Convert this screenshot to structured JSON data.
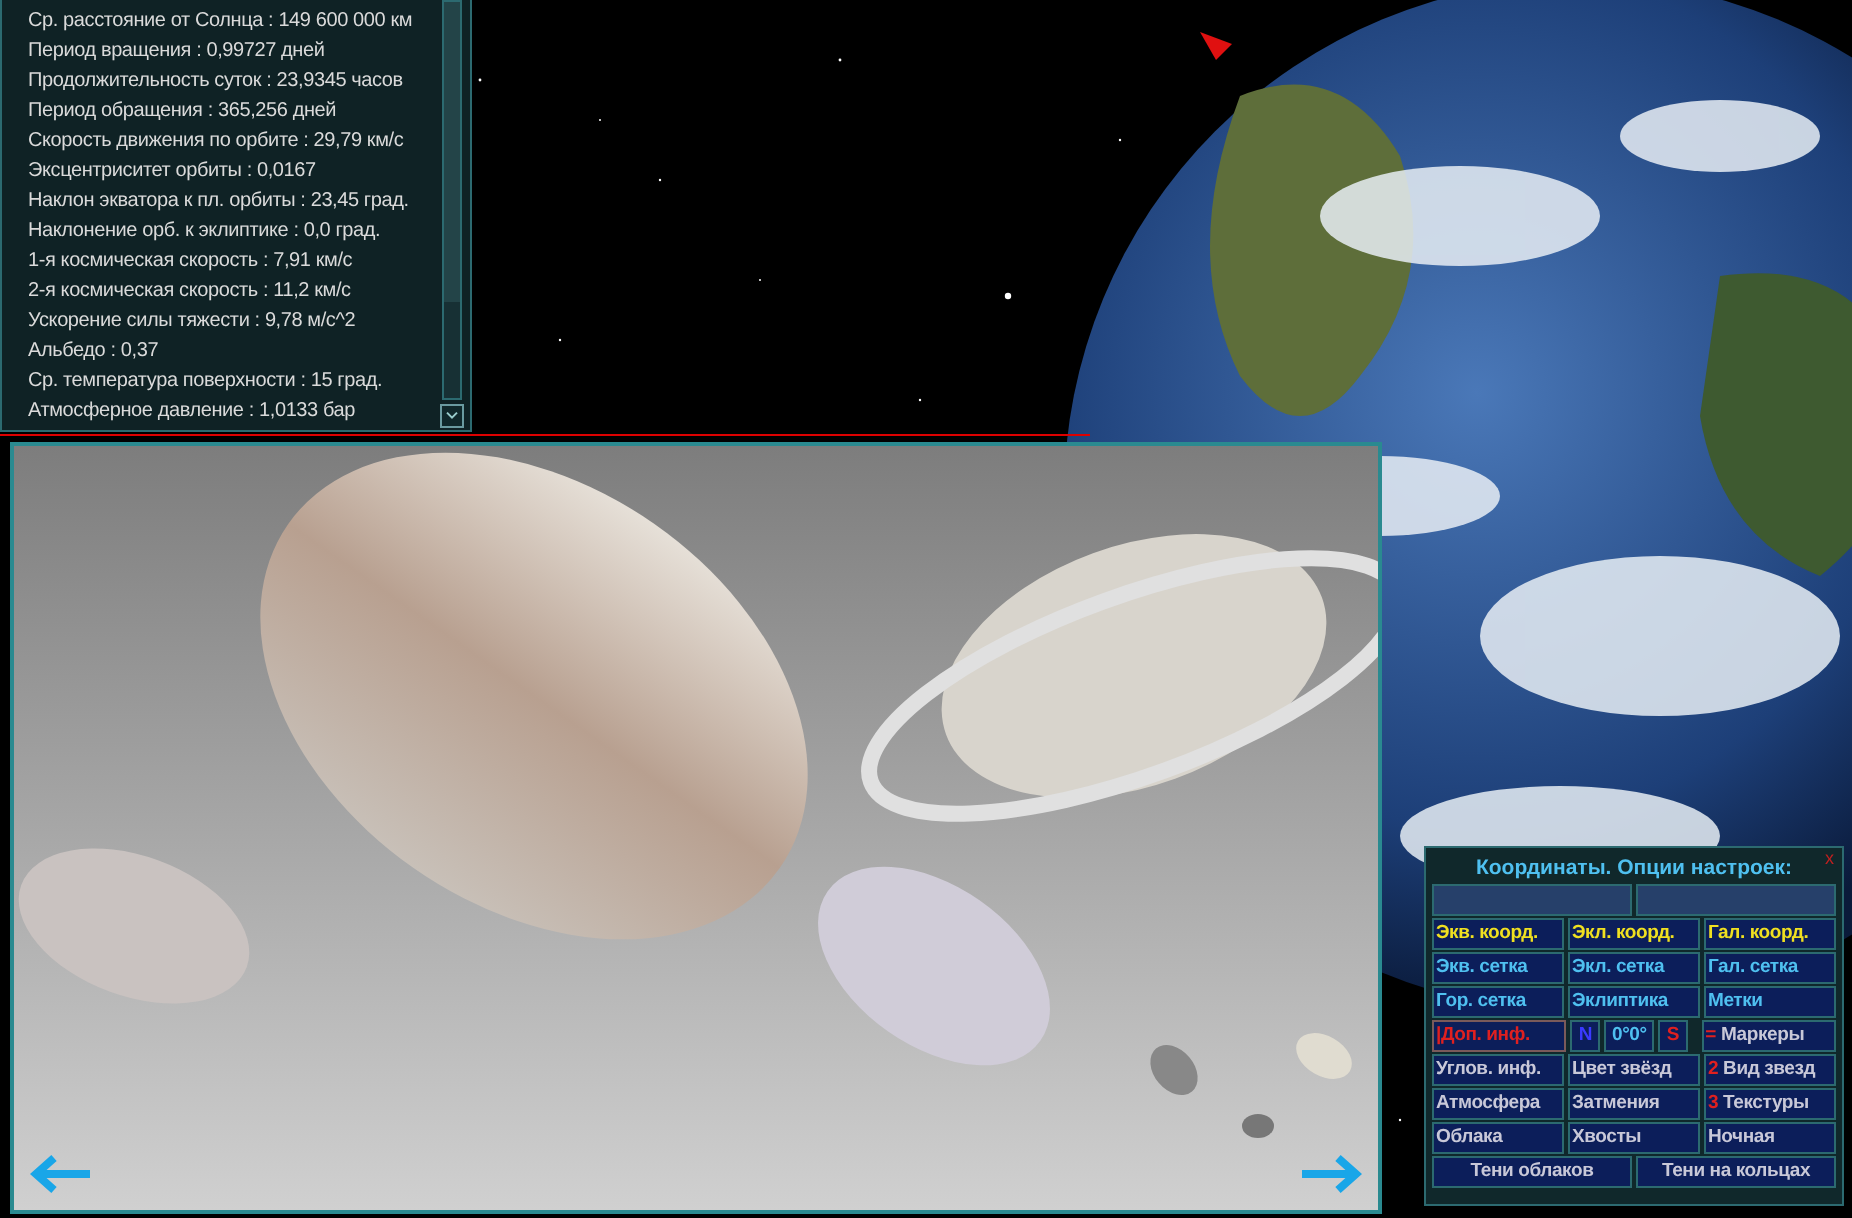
{
  "info_panel": {
    "lines": [
      "Ср. расстояние от Солнца : 149 600 000 км",
      "Период вращения : 0,99727 дней",
      "Продолжительность суток : 23,9345 часов",
      "Период обращения : 365,256 дней",
      "Скорость движения по орбите : 29,79 км/с",
      "Эксцентриситет орбиты : 0,0167",
      "Наклон экватора к пл. орбиты : 23,45 град.",
      "Наклонение орб. к эклиптике : 0,0 град.",
      "1-я космическая скорость : 7,91 км/с",
      "2-я космическая скорость : 11,2 км/с",
      "Ускорение силы тяжести : 9,78 м/с^2",
      "Альбедо : 0,37",
      "Ср. температура поверхности : 15  град.",
      "Атмосферное давление : 1,0133 бар"
    ]
  },
  "options_panel": {
    "title": "Координаты. Опции настроек:",
    "close": "x",
    "fields": [
      {
        "kind": "input"
      },
      {
        "kind": "input"
      }
    ],
    "rows": [
      [
        {
          "kind": "coords",
          "label": "Экв. коорд."
        },
        {
          "kind": "coords",
          "label": "Экл. коорд."
        },
        {
          "kind": "coords",
          "label": "Гал. коорд."
        }
      ],
      [
        {
          "kind": "grid",
          "label": "Экв. сетка"
        },
        {
          "kind": "grid",
          "label": "Экл. сетка"
        },
        {
          "kind": "grid",
          "label": "Гал. сетка"
        }
      ],
      [
        {
          "kind": "grid",
          "label": "Гор. сетка"
        },
        {
          "kind": "grid",
          "label": "Эклиптика"
        },
        {
          "kind": "grid",
          "label": "Метки"
        }
      ],
      [
        {
          "kind": "alert",
          "label": "|Доп. инф."
        },
        {
          "parts": [
            {
              "kind": "north",
              "label": "N"
            },
            {
              "kind": "grid",
              "label": "0°0°"
            },
            {
              "kind": "alert",
              "label": "S"
            }
          ]
        },
        {
          "kind": "plain",
          "prefix": "=",
          "label": "Маркеры"
        }
      ],
      [
        {
          "kind": "plain",
          "label": "Углов. инф."
        },
        {
          "kind": "plain",
          "label": "Цвет звёзд"
        },
        {
          "kind": "plain",
          "prefix": "2",
          "label": "Вид звезд"
        }
      ],
      [
        {
          "kind": "plain",
          "label": "Атмосфера"
        },
        {
          "kind": "plain",
          "label": "Затмения"
        },
        {
          "kind": "plain",
          "prefix": "3",
          "label": "Текстуры"
        }
      ],
      [
        {
          "kind": "plain",
          "label": "Облака"
        },
        {
          "kind": "plain",
          "label": "Хвосты"
        },
        {
          "kind": "plain",
          "label": "Ночная"
        }
      ],
      [
        {
          "kind": "plain",
          "label": "Тени облаков"
        },
        {
          "kind": "plain",
          "label": "Тени на кольцах"
        }
      ]
    ]
  }
}
